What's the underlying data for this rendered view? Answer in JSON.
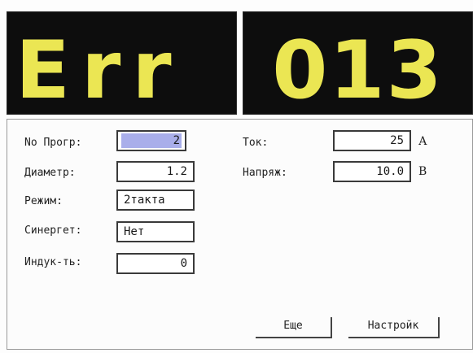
{
  "display": {
    "left_text": "Err",
    "right_text": "013",
    "text_color": "#ebe653",
    "background_color": "#0d0d0d"
  },
  "params_left": [
    {
      "label": "No Прогр:",
      "value": "2"
    },
    {
      "label": "Диаметр:",
      "value": "1.2"
    },
    {
      "label": "Режим:",
      "value": "2такта"
    },
    {
      "label": "Синергет:",
      "value": "Нет"
    },
    {
      "label": "Индук-ть:",
      "value": "0"
    }
  ],
  "params_right": [
    {
      "label": "Ток:",
      "value": "25",
      "unit": "А"
    },
    {
      "label": "Напряж:",
      "value": "10.0",
      "unit": "В"
    }
  ],
  "buttons": {
    "more_label": "Еще",
    "settings_label": "Настройк"
  },
  "selection_color": "#a9aeea"
}
